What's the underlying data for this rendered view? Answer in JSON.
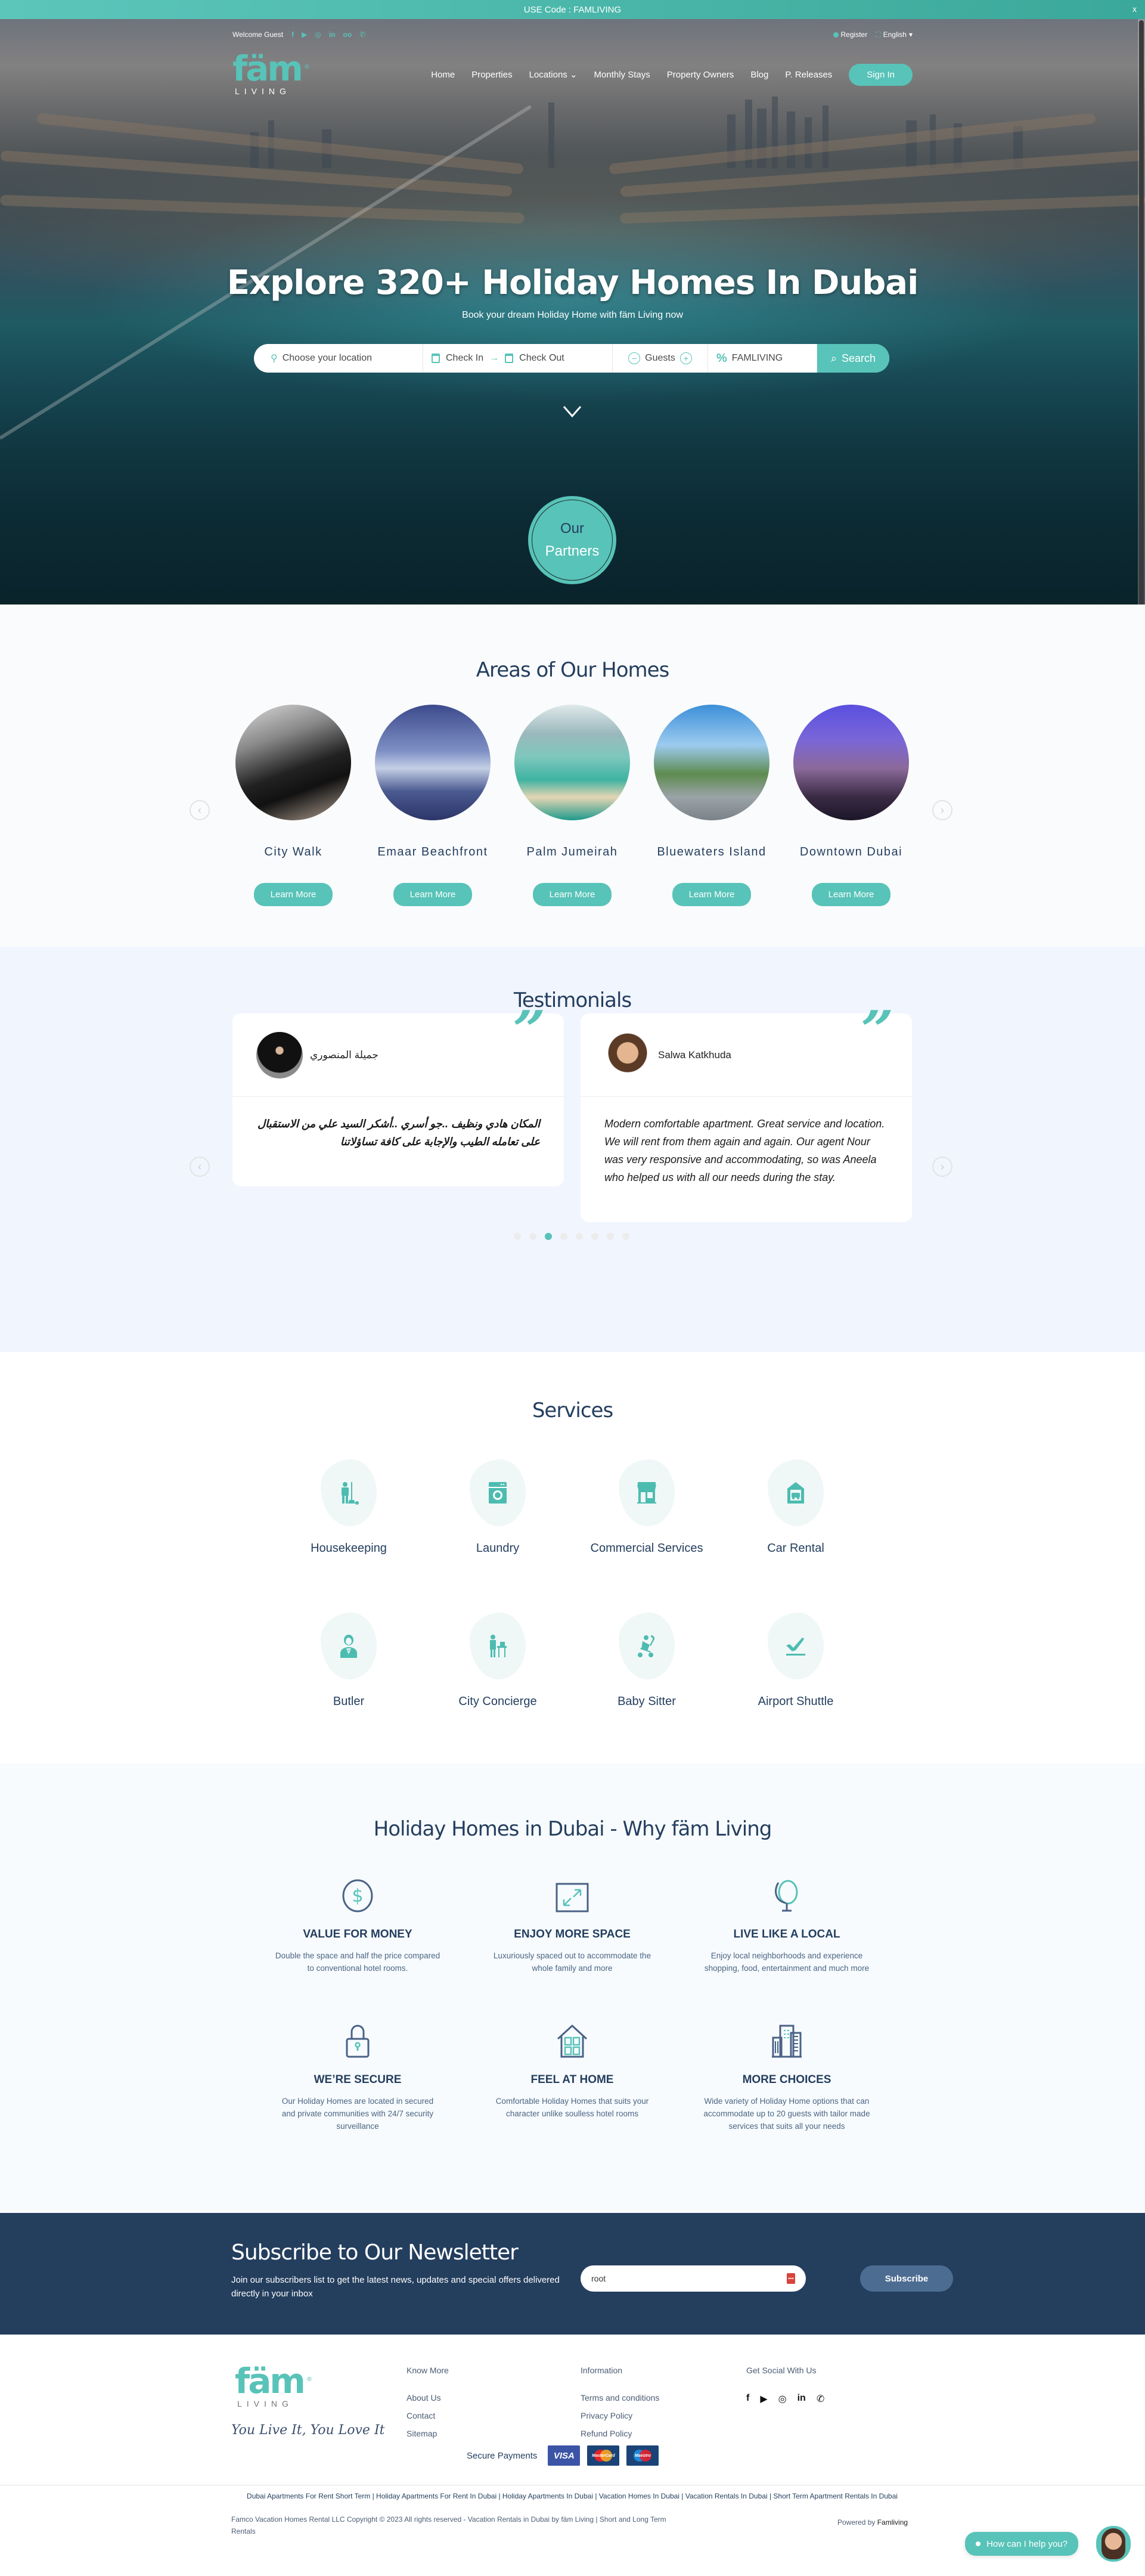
{
  "promo": {
    "text": "USE Code : FAMLIVING",
    "close_label": "x"
  },
  "topbar": {
    "welcome": "Welcome Guest",
    "social_icons": [
      "facebook-icon",
      "youtube-icon",
      "instagram-icon",
      "linkedin-icon",
      "tripadvisor-icon",
      "whatsapp-icon"
    ],
    "register": "Register",
    "language": "English"
  },
  "logo": {
    "mark": "fäm",
    "registered": "®",
    "sub": "LIVING"
  },
  "nav": {
    "items": [
      "Home",
      "Properties",
      "Locations",
      "Monthly Stays",
      "Property Owners",
      "Blog",
      "P. Releases"
    ],
    "signin": "Sign In"
  },
  "hero": {
    "title": "Explore 320+ Holiday Homes In Dubai",
    "subtitle": "Book your dream Holiday Home with fäm Living now",
    "search": {
      "location_placeholder": "Choose your location",
      "check_in": "Check In",
      "check_out": "Check Out",
      "guests": "Guests",
      "promo_code": "FAMLIVING",
      "button": "Search"
    },
    "partners": {
      "line1": "Our",
      "line2": "Partners"
    }
  },
  "areas": {
    "title": "Areas of Our Homes",
    "items": [
      {
        "name": "City Walk",
        "button": "Learn More"
      },
      {
        "name": "Emaar Beachfront",
        "button": "Learn More"
      },
      {
        "name": "Palm Jumeirah",
        "button": "Learn More"
      },
      {
        "name": "Bluewaters Island",
        "button": "Learn More"
      },
      {
        "name": "Downtown Dubai",
        "button": "Learn More"
      }
    ]
  },
  "testimonials": {
    "title": "Testimonials",
    "items": [
      {
        "author": "جميلة المنصوري",
        "text": "المكان هادي ونظيف ..جو أسري ..أشكر السيد علي من الاستقبال على تعامله الطيب والإجابة على كافة تساؤلاتنا"
      },
      {
        "author": "Salwa Katkhuda",
        "text": "Modern comfortable apartment. Great service and location. We will rent from them again and again. Our agent Nour was very responsive and accommodating, so was Aneela who helped us with all our needs during the stay."
      }
    ],
    "dot_count": 8,
    "active_dot": 3
  },
  "services": {
    "title": "Services",
    "items": [
      {
        "label": "Housekeeping",
        "icon": "housekeeping-icon"
      },
      {
        "label": "Laundry",
        "icon": "washing-machine-icon"
      },
      {
        "label": "Commercial Services",
        "icon": "storefront-icon"
      },
      {
        "label": "Car Rental",
        "icon": "car-garage-icon"
      },
      {
        "label": "Butler",
        "icon": "butler-icon"
      },
      {
        "label": "City Concierge",
        "icon": "concierge-icon"
      },
      {
        "label": "Baby Sitter",
        "icon": "stroller-icon"
      },
      {
        "label": "Airport Shuttle",
        "icon": "plane-landing-icon"
      }
    ]
  },
  "why": {
    "title": "Holiday Homes in Dubai - Why fäm Living",
    "features": [
      {
        "title": "VALUE FOR MONEY",
        "text": "Double the space and half the price compared to conventional hotel rooms."
      },
      {
        "title": "ENJOY MORE SPACE",
        "text": "Luxuriously spaced out to accommodate the whole family and more"
      },
      {
        "title": "LIVE LIKE A LOCAL",
        "text": "Enjoy local neighborhoods and experience shopping, food, entertainment and much more"
      },
      {
        "title": "WE’RE SECURE",
        "text": "Our Holiday Homes are located in secured and private communities with 24/7 security surveillance"
      },
      {
        "title": "FEEL AT HOME",
        "text": "Comfortable Holiday Homes that suits your character unlike soulless hotel rooms"
      },
      {
        "title": "MORE CHOICES",
        "text": "Wide variety of Holiday Home options that can accommodate up to 20 guests with tailor made services that suits all your needs"
      }
    ]
  },
  "newsletter": {
    "title": "Subscribe to Our Newsletter",
    "text": "Join our subscribers list to get the latest news, updates and special offers delivered directly in your inbox",
    "email_value": "root",
    "button": "Subscribe"
  },
  "footer": {
    "tagline": "You Live It, You Love It",
    "know_more": {
      "title": "Know More",
      "links": [
        "About Us",
        "Contact",
        "Sitemap"
      ]
    },
    "information": {
      "title": "Information",
      "links": [
        "Terms and conditions",
        "Privacy Policy",
        "Refund Policy"
      ]
    },
    "social": {
      "title": "Get Social With Us",
      "icons": [
        "facebook-icon",
        "youtube-icon",
        "instagram-icon",
        "linkedin-icon",
        "whatsapp-icon"
      ]
    },
    "payments": {
      "label": "Secure Payments",
      "cards": [
        "VISA",
        "MasterCard",
        "Maestro"
      ]
    },
    "seo_links": "Dubai Apartments For Rent Short Term | Holiday Apartments For Rent In Dubai | Holiday Apartments In Dubai | Vacation Homes In Dubai | Vacation Rentals In Dubai | Short Term Apartment Rentals In Dubai",
    "copyright": "Famco Vacation Homes Rental LLC Copyright © 2023 All rights reserved - Vacation Rentals in Dubai by fäm Living | Short and Long Term Rentals",
    "powered_prefix": "Powered by",
    "powered_brand": "Famliving"
  },
  "chat": {
    "text": "How can I help you?"
  },
  "colors": {
    "accent": "#58c3b8",
    "navy": "#243e5e",
    "newsletter_bg": "#243e5e",
    "subscribe_btn": "#4d6c92"
  }
}
